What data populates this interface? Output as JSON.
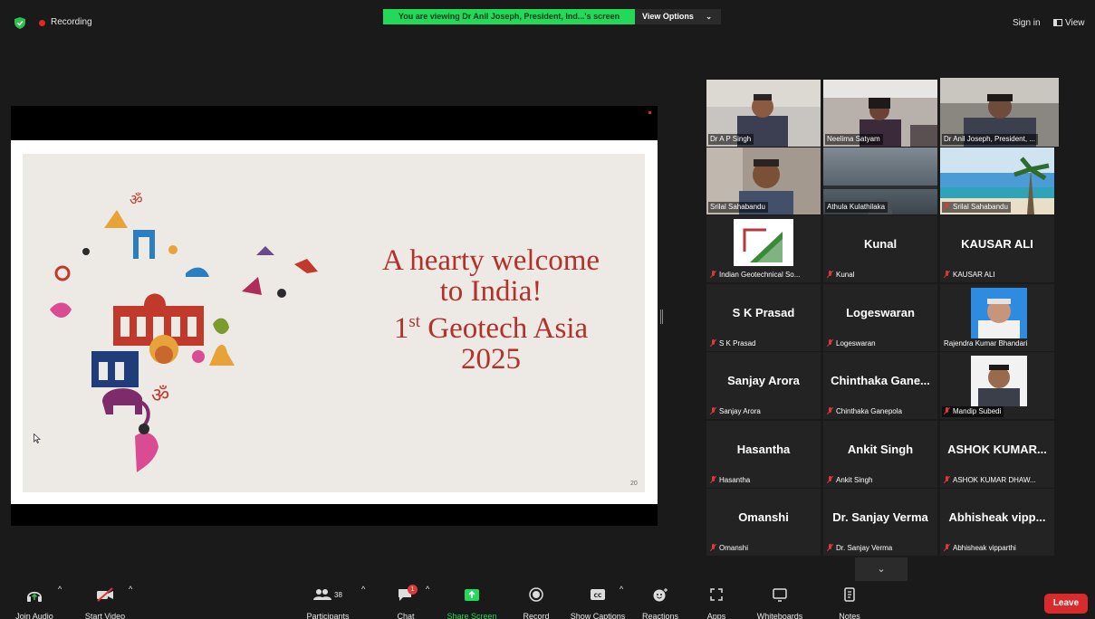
{
  "topbar": {
    "recording": "Recording",
    "viewing_banner": "You are viewing Dr Anil Joseph, President, Ind...'s screen",
    "view_options": "View Options",
    "sign_in": "Sign in",
    "view": "View"
  },
  "slide": {
    "line1": "A hearty  welcome",
    "line2": "to  India!",
    "line3_sup": "st",
    "line3_pre": "1",
    "line3_post": " Geotech Asia",
    "line4": "2025",
    "page_number": "20"
  },
  "participants": [
    {
      "label": "Dr A P Singh",
      "muted": false,
      "video": true
    },
    {
      "label": "Neelima Satyam",
      "muted": false,
      "video": true
    },
    {
      "label": "Dr Anil Joseph, President, ...",
      "muted": false,
      "video": true,
      "active": true
    },
    {
      "label": "Srilal Sahabandu",
      "muted": false,
      "video": true
    },
    {
      "label": "Athula Kulathilaka",
      "muted": false,
      "video": true
    },
    {
      "label": "Srilal Sahabandu",
      "muted": true,
      "video": true
    },
    {
      "label": "Indian Geotechnical So...",
      "muted": true,
      "logo": true
    },
    {
      "label": "Kunal",
      "display": "Kunal",
      "muted": true
    },
    {
      "label": "KAUSAR ALI",
      "display": "KAUSAR ALI",
      "muted": true
    },
    {
      "label": "S K Prasad",
      "display": "S K Prasad",
      "muted": true
    },
    {
      "label": "Logeswaran",
      "display": "Logeswaran",
      "muted": true
    },
    {
      "label": "Rajendra Kumar Bhandari",
      "muted": false,
      "photo": true
    },
    {
      "label": "Sanjay Arora",
      "display": "Sanjay Arora",
      "muted": true
    },
    {
      "label": "Chinthaka Ganepola",
      "display": "Chinthaka  Gane...",
      "muted": true
    },
    {
      "label": "Mandip Subedi",
      "muted": true,
      "photo": true
    },
    {
      "label": "Hasantha",
      "display": "Hasantha",
      "muted": true
    },
    {
      "label": "Ankit Singh",
      "display": "Ankit Singh",
      "muted": true
    },
    {
      "label": "ASHOK KUMAR DHAW...",
      "display": "ASHOK  KUMAR...",
      "muted": true
    },
    {
      "label": "Omanshi",
      "display": "Omanshi",
      "muted": true
    },
    {
      "label": "Dr. Sanjay Verma",
      "display": "Dr. Sanjay Verma",
      "muted": true
    },
    {
      "label": "Abhisheak vipparthi",
      "display": "Abhisheak  vipp...",
      "muted": true
    }
  ],
  "toolbar": {
    "join_audio": "Join Audio",
    "start_video": "Start Video",
    "participants": "Participants",
    "participants_count": "38",
    "chat": "Chat",
    "chat_badge": "1",
    "share_screen": "Share Screen",
    "record": "Record",
    "show_captions": "Show Captions",
    "reactions": "Reactions",
    "apps": "Apps",
    "whiteboards": "Whiteboards",
    "notes": "Notes",
    "leave": "Leave"
  },
  "colors": {
    "banner_green": "#23d959",
    "slide_text_red": "#b4312b",
    "active_speaker": "#c4e53f",
    "leave_red": "#d92b2b",
    "share_green": "#23d959"
  }
}
